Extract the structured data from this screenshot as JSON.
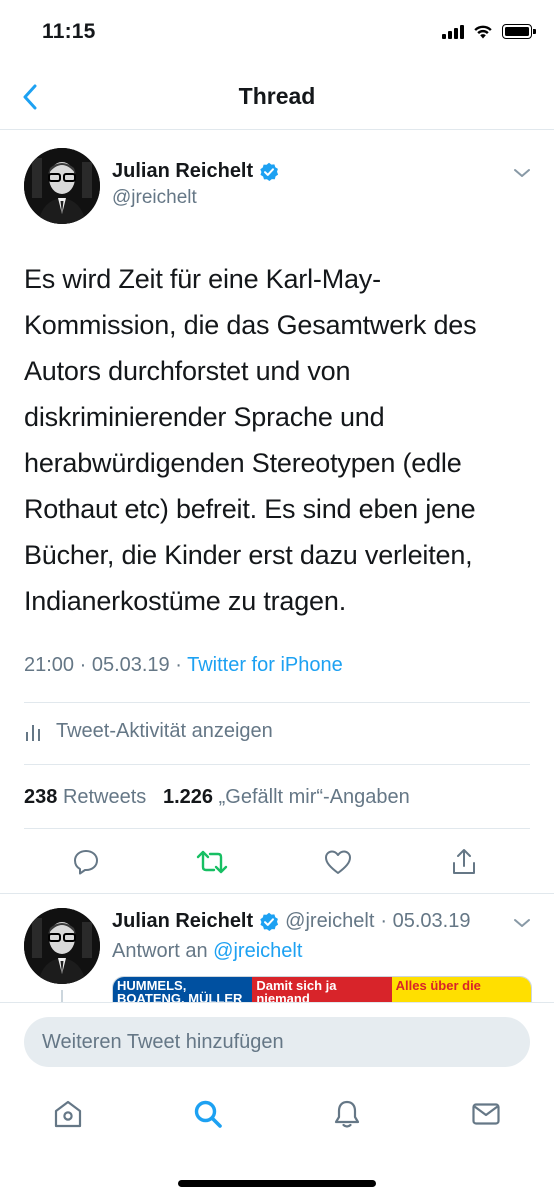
{
  "status_bar": {
    "time": "11:15"
  },
  "nav": {
    "title": "Thread"
  },
  "tweet": {
    "author_name": "Julian Reichelt",
    "author_handle": "@jreichelt",
    "text_lines": [
      "Es wird Zeit für eine Karl-May-",
      "Kommission, die das Gesamtwerk des",
      "Autors durchforstet und von",
      "diskriminierender Sprache und",
      "herabwürdigenden Stereotypen (edle",
      "Rothaut etc) befreit. Es sind eben jene",
      "Bücher, die Kinder erst dazu verleiten,",
      "Indianerkostüme zu tragen."
    ],
    "time_date": "21:00 · 05.03.19 · ",
    "source": "Twitter for iPhone",
    "activity_label": "Tweet-Aktivität anzeigen",
    "retweet_count": "238",
    "retweet_label": "Retweets",
    "like_count": "1.226",
    "like_label": "„Gefällt mir“-Angaben"
  },
  "reply": {
    "author_name": "Julian Reichelt",
    "author_handle": "@jreichelt",
    "date": "· 05.03.19",
    "reply_prefix": "Antwort an ",
    "reply_to": "@jreichelt",
    "media_headlines": [
      "HUMMELS, BOATENG, MÜLLER",
      "Damit sich ja niemand diskriminiert fühlt",
      "Alles über die"
    ]
  },
  "compose": {
    "placeholder": "Weiteren Tweet hinzufügen"
  },
  "colors": {
    "accent": "#1da1f2",
    "retweet_green": "#17bf63",
    "text_secondary": "#657786",
    "verified": "#1da1f2"
  },
  "icons": {
    "back": "chevron-left-icon",
    "verified": "verified-badge-icon",
    "more": "chevron-down-icon",
    "activity": "bar-chart-icon",
    "reply": "comment-icon",
    "retweet": "retweet-icon",
    "like": "heart-icon",
    "share": "share-icon",
    "home": "home-icon",
    "search": "search-icon",
    "notifications": "bell-icon",
    "messages": "envelope-icon"
  }
}
